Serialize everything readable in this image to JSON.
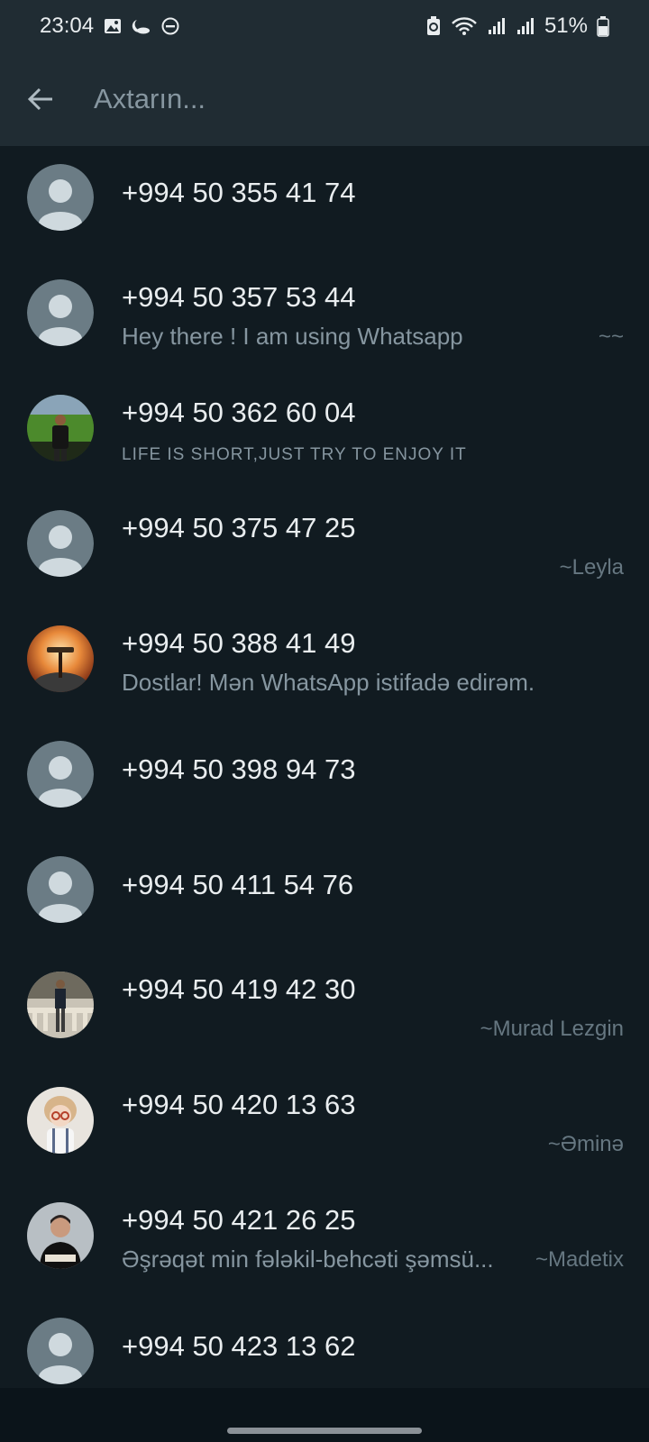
{
  "status_bar": {
    "time": "23:04",
    "battery": "51%",
    "left_icons": [
      "gallery-icon",
      "weather-icon",
      "dnd-icon"
    ],
    "right_icons": [
      "battery-saver-icon",
      "wifi-icon",
      "signal-icon",
      "signal-icon",
      "battery-icon"
    ]
  },
  "search": {
    "placeholder": "Axtarın...",
    "value": ""
  },
  "contacts": [
    {
      "number": "+994 50 355 41 74",
      "about": "",
      "pushname": "",
      "avatar": "default"
    },
    {
      "number": "+994 50 357 53 44",
      "about": "Hey there ! I am using Whatsapp",
      "pushname": "~~",
      "avatar": "default"
    },
    {
      "number": "+994 50 362 60 04",
      "about": "LIFE IS SHORT,JUST TRY TO ENJOY IT",
      "pushname": "",
      "avatar": "photo-stadium"
    },
    {
      "number": "+994 50 375 47 25",
      "about": "",
      "pushname": "~Leyla",
      "avatar": "default"
    },
    {
      "number": "+994 50 388 41 49",
      "about": "Dostlar! Mən WhatsApp istifadə edirəm.",
      "pushname": "",
      "avatar": "photo-sunset"
    },
    {
      "number": "+994 50 398 94 73",
      "about": "",
      "pushname": "",
      "avatar": "default"
    },
    {
      "number": "+994 50 411 54 76",
      "about": "",
      "pushname": "",
      "avatar": "default"
    },
    {
      "number": "+994 50 419 42 30",
      "about": "",
      "pushname": "~Murad Lezgin",
      "avatar": "photo-balcony"
    },
    {
      "number": "+994 50 420 13 63",
      "about": "",
      "pushname": "~Əminə",
      "avatar": "photo-child"
    },
    {
      "number": "+994 50 421 26 25",
      "about": "Əşrəqət min fələkil-behcəti şəmsü...",
      "pushname": "~Madetix",
      "avatar": "photo-man"
    },
    {
      "number": "+994 50 423 13 62",
      "about": "",
      "pushname": "",
      "avatar": "default"
    }
  ],
  "colors": {
    "background": "#111b21",
    "header": "#202c33",
    "primary_text": "#e9edef",
    "secondary_text": "#8696a0",
    "default_avatar": "#6b7c85"
  }
}
